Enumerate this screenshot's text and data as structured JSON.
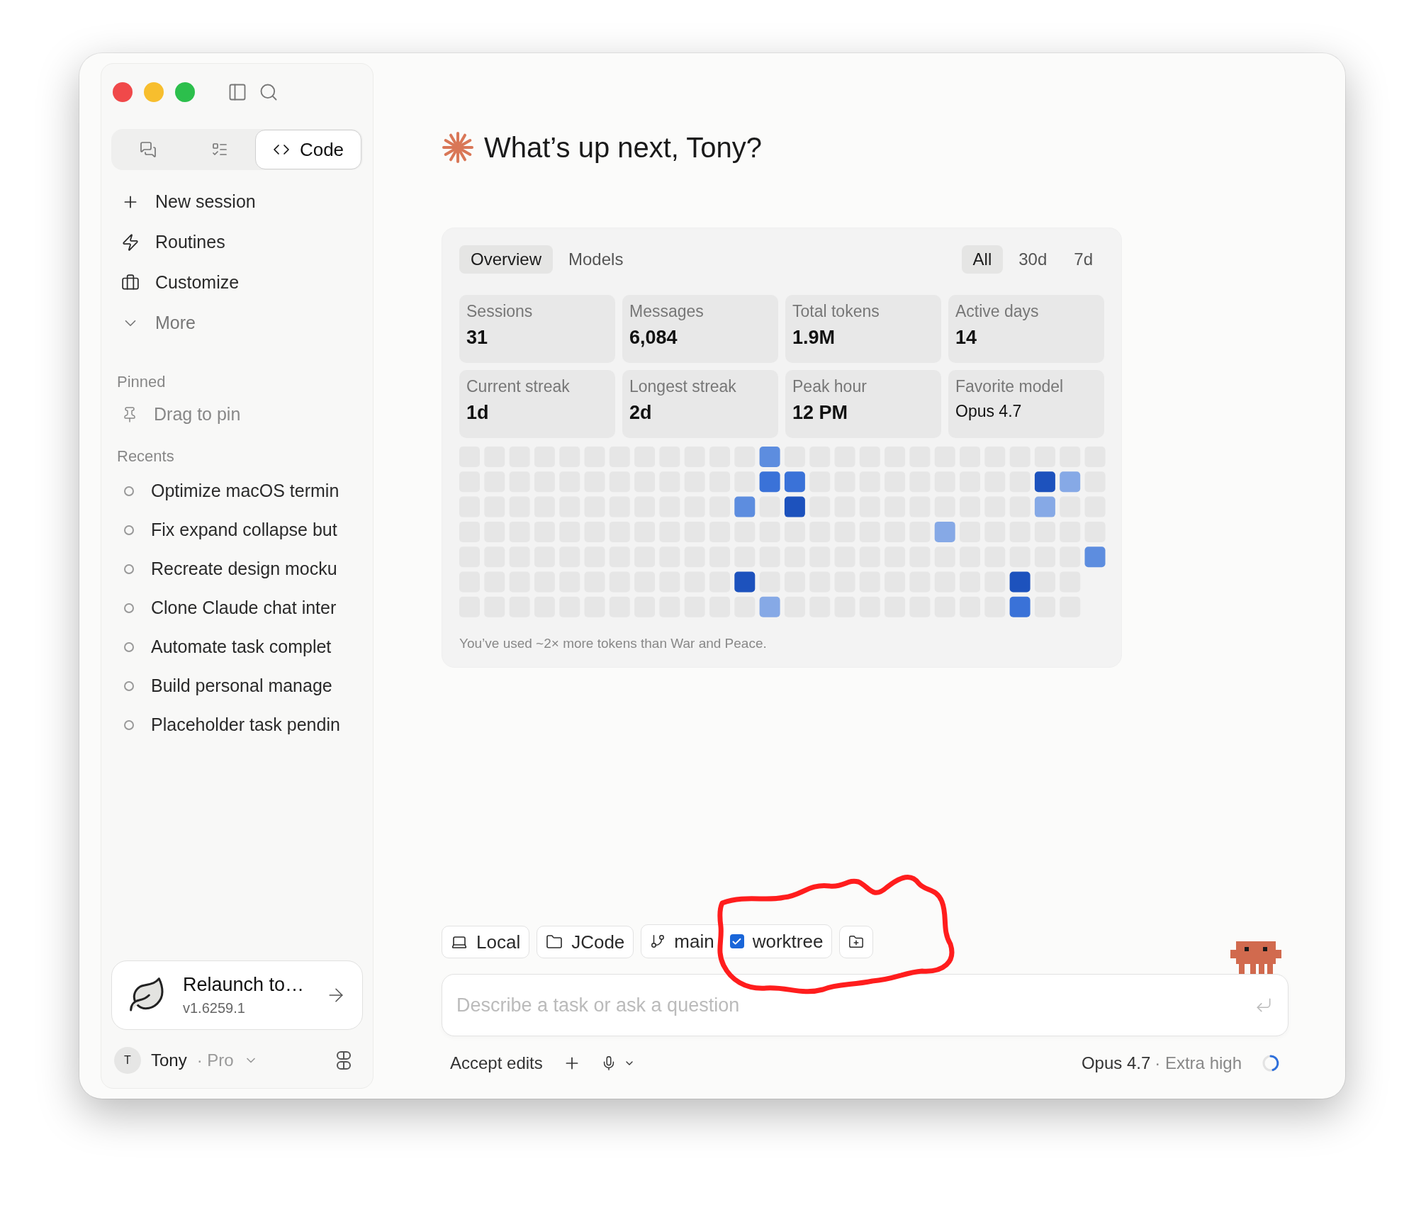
{
  "sidebar": {
    "modes": [
      {
        "kind": "chats",
        "selected": false
      },
      {
        "kind": "tasks",
        "selected": false
      },
      {
        "kind": "code",
        "label": "Code",
        "selected": true
      }
    ],
    "nav": [
      {
        "kind": "new",
        "label": "New session"
      },
      {
        "kind": "routines",
        "label": "Routines"
      },
      {
        "kind": "customize",
        "label": "Customize"
      },
      {
        "kind": "more",
        "label": "More"
      }
    ],
    "pinned": {
      "heading": "Pinned",
      "hint": "Drag to pin"
    },
    "recents": {
      "heading": "Recents",
      "items": [
        "Optimize macOS termin",
        "Fix expand collapse but",
        "Recreate design mocku",
        "Clone Claude chat inter",
        "Automate task complet",
        "Build personal manage",
        "Placeholder task pendin"
      ]
    },
    "update_card": {
      "title": "Relaunch to…",
      "version": "v1.6259.1"
    },
    "account": {
      "initial": "T",
      "name": "Tony",
      "plan": "· Pro"
    }
  },
  "greeting": "What’s up next, Tony?",
  "stats": {
    "tabs": [
      {
        "label": "Overview",
        "selected": true
      },
      {
        "label": "Models",
        "selected": false
      }
    ],
    "ranges": [
      {
        "label": "All",
        "selected": true
      },
      {
        "label": "30d",
        "selected": false
      },
      {
        "label": "7d",
        "selected": false
      }
    ],
    "tiles": [
      {
        "kind": "number",
        "label": "Sessions",
        "value": "31"
      },
      {
        "kind": "number",
        "label": "Messages",
        "value": "6,084"
      },
      {
        "kind": "number",
        "label": "Total tokens",
        "value": "1.9M"
      },
      {
        "kind": "number",
        "label": "Active days",
        "value": "14"
      },
      {
        "kind": "number",
        "label": "Current streak",
        "value": "1d"
      },
      {
        "kind": "number",
        "label": "Longest streak",
        "value": "2d"
      },
      {
        "kind": "number",
        "label": "Peak hour",
        "value": "12 PM"
      },
      {
        "kind": "text",
        "label": "Favorite model",
        "value": "Opus 4.7"
      }
    ],
    "note": "You’ve used ~2× more tokens than War and Peace."
  },
  "composer": {
    "chips": [
      {
        "kind": "environment",
        "label": "Local"
      },
      {
        "kind": "folder",
        "label": "JCode"
      },
      {
        "kind": "branch",
        "label": "main",
        "worktree": {
          "label": "worktree",
          "checked": true
        }
      },
      {
        "kind": "add-folder"
      }
    ],
    "placeholder": "Describe a task or ask a question",
    "mode": "Accept edits",
    "model": "Opus 4.7",
    "effort": "· Extra high"
  }
}
